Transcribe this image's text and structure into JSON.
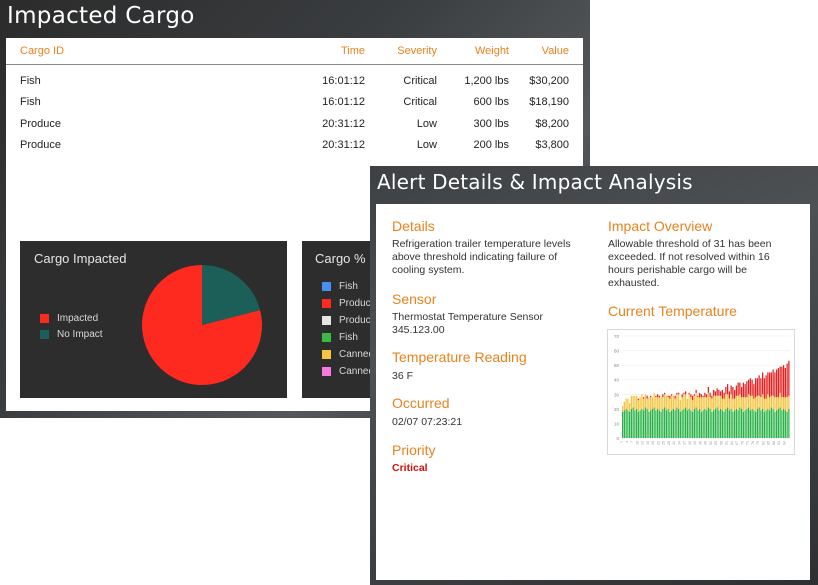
{
  "cargo_window": {
    "title": "Impacted Cargo",
    "table": {
      "headers": {
        "id": "Cargo ID",
        "time": "Time",
        "severity": "Severity",
        "weight": "Weight",
        "value": "Value"
      },
      "rows": [
        {
          "id": "Fish",
          "time": "16:01:12",
          "severity": "Critical",
          "weight": "1,200 lbs",
          "value": "$30,200"
        },
        {
          "id": "Fish",
          "time": "16:01:12",
          "severity": "Critical",
          "weight": "600 lbs",
          "value": "$18,190"
        },
        {
          "id": "Produce",
          "time": "20:31:12",
          "severity": "Low",
          "weight": "300 lbs",
          "value": "$8,200"
        },
        {
          "id": "Produce",
          "time": "20:31:12",
          "severity": "Low",
          "weight": "200 lbs",
          "value": "$3,800"
        }
      ]
    },
    "impacted_tile": {
      "title": "Cargo Impacted",
      "legend": [
        {
          "label": "Impacted",
          "color": "#ff2a1f"
        },
        {
          "label": "No Impact",
          "color": "#1c5e58"
        }
      ]
    },
    "pct_tile": {
      "title": "Cargo %",
      "legend": [
        {
          "label": "Fish",
          "color": "#4a8ff0"
        },
        {
          "label": "Produce",
          "color": "#ff2a1f"
        },
        {
          "label": "Produce",
          "color": "#e6e6e6"
        },
        {
          "label": "Fish",
          "color": "#3cb844"
        },
        {
          "label": "Canned",
          "color": "#f5c542"
        },
        {
          "label": "Canned",
          "color": "#f57ae0"
        }
      ]
    }
  },
  "alert_window": {
    "title": "Alert Details & Impact Analysis",
    "details_head": "Details",
    "details_body": "Refrigeration trailer temperature levels above threshold indicating failure of cooling system.",
    "sensor_head": "Sensor",
    "sensor_body_line1": "Thermostat Temperature Sensor",
    "sensor_body_line2": "345.123.00",
    "reading_head": "Temperature Reading",
    "reading_body": "36 F",
    "occurred_head": "Occurred",
    "occurred_body": "02/07 07:23:21",
    "priority_head": "Priority",
    "priority_body": "Critical",
    "impact_head": "Impact Overview",
    "impact_body": "Allowable threshold of 31 has been exceeded. If not resolved within 16 hours perishable cargo will be exhausted.",
    "current_temp_head": "Current Temperature"
  },
  "chart_data": [
    {
      "type": "pie",
      "title": "Cargo Impacted",
      "labels": [
        "Impacted",
        "No Impact"
      ],
      "values": [
        79,
        21
      ],
      "colors": [
        "#ff2a1f",
        "#1c5e58"
      ]
    },
    {
      "type": "bar",
      "stacked": true,
      "title": "Current Temperature",
      "ylim": [
        0,
        70
      ],
      "yticks": [
        0,
        10,
        20,
        30,
        40,
        50,
        60,
        70
      ],
      "bar_count": 96,
      "series": [
        {
          "color": "#2bb34a",
          "values": [
            18,
            19,
            20,
            19,
            18,
            20,
            21,
            19,
            20,
            18,
            19,
            20,
            19,
            21,
            20,
            18,
            19,
            20,
            21,
            19,
            20,
            19,
            18,
            20,
            21,
            19,
            20,
            18,
            19,
            20,
            19,
            21,
            20,
            18,
            19,
            20,
            21,
            19,
            20,
            19,
            18,
            20,
            21,
            19,
            20,
            18,
            19,
            20,
            19,
            21,
            20,
            18,
            19,
            20,
            21,
            19,
            20,
            19,
            18,
            20,
            21,
            19,
            20,
            18,
            19,
            20,
            19,
            21,
            20,
            18,
            19,
            20,
            21,
            19,
            20,
            19,
            18,
            20,
            21,
            19,
            20,
            18,
            19,
            20,
            19,
            21,
            20,
            18,
            19,
            20,
            21,
            19,
            20,
            19,
            18,
            20
          ]
        },
        {
          "color": "#f5c542",
          "values": [
            4,
            6,
            7,
            8,
            6,
            9,
            8,
            10,
            9,
            8,
            9,
            10,
            8,
            9,
            7,
            10,
            9,
            8,
            10,
            9,
            8,
            9,
            10,
            8,
            9,
            10,
            8,
            9,
            10,
            9,
            8,
            9,
            10,
            8,
            9,
            10,
            9,
            8,
            10,
            9,
            8,
            9,
            10,
            9,
            8,
            10,
            9,
            8,
            9,
            10,
            8,
            9,
            10,
            9,
            8,
            10,
            9,
            8,
            9,
            10,
            9,
            8,
            10,
            9,
            8,
            9,
            10,
            9,
            8,
            10,
            9,
            8,
            9,
            10,
            9,
            8,
            10,
            9,
            8,
            9,
            10,
            9,
            8,
            10,
            9,
            8,
            9,
            10,
            9,
            8,
            10,
            9,
            8,
            9,
            10,
            9
          ]
        },
        {
          "color": "#e62020",
          "values": [
            0,
            0,
            0,
            0,
            0,
            0,
            0,
            0,
            0,
            1,
            0,
            0,
            1,
            0,
            2,
            0,
            1,
            0,
            0,
            1,
            2,
            1,
            0,
            2,
            1,
            0,
            1,
            2,
            1,
            0,
            2,
            1,
            1,
            0,
            2,
            1,
            2,
            0,
            1,
            2,
            3,
            1,
            2,
            1,
            3,
            2,
            1,
            3,
            2,
            4,
            3,
            2,
            4,
            3,
            5,
            4,
            3,
            6,
            4,
            5,
            7,
            5,
            6,
            8,
            6,
            7,
            9,
            8,
            7,
            10,
            9,
            11,
            10,
            12,
            11,
            10,
            13,
            12,
            14,
            13,
            15,
            14,
            16,
            15,
            17,
            16,
            18,
            17,
            19,
            20,
            18,
            21,
            22,
            20,
            23,
            24
          ]
        }
      ]
    }
  ]
}
